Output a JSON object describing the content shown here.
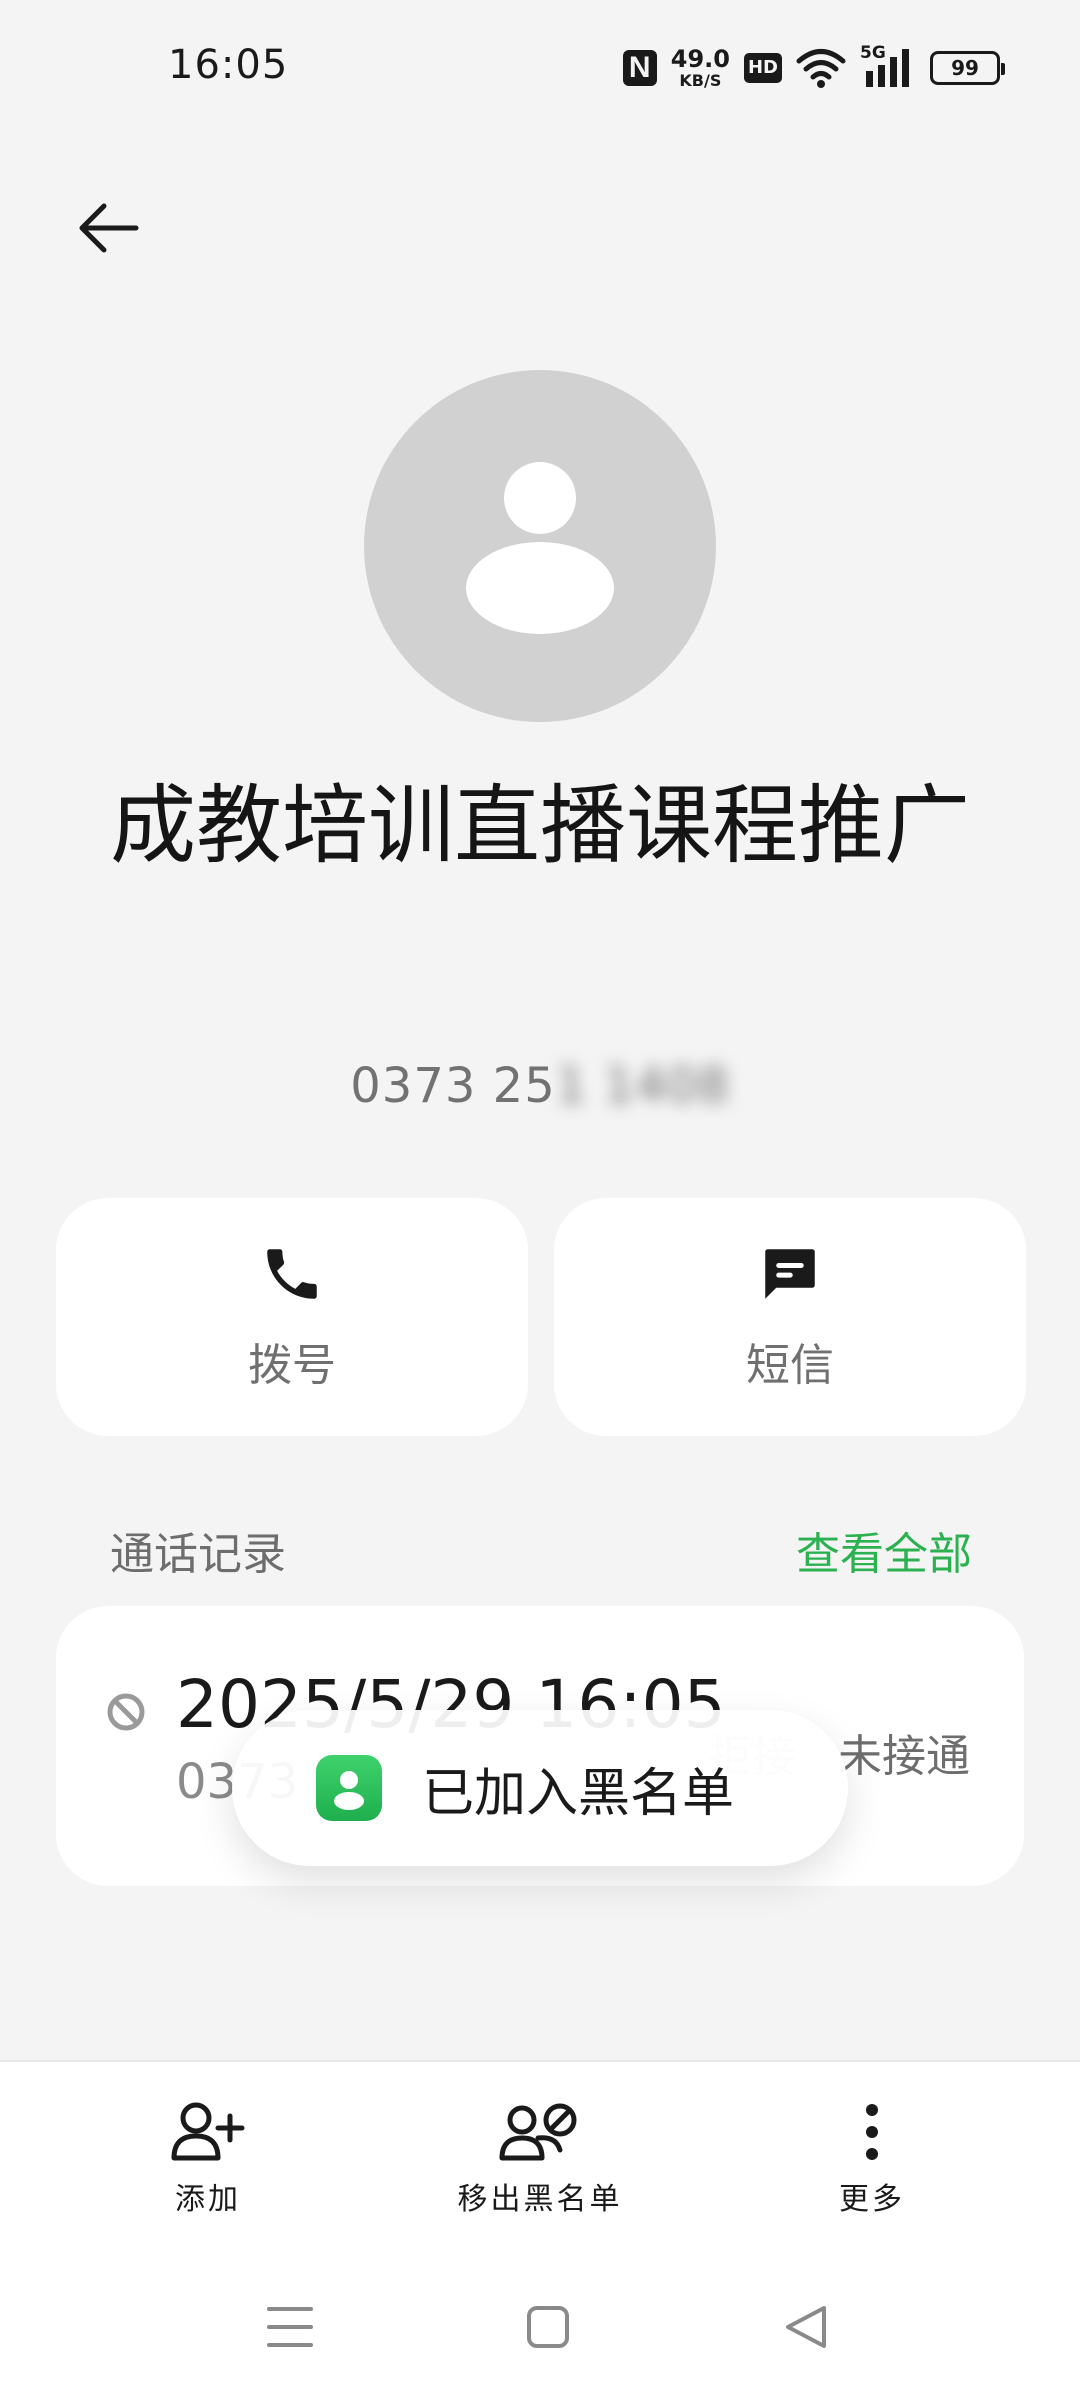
{
  "status_bar": {
    "time": "16:05",
    "net_speed_value": "49.0",
    "net_speed_unit": "KB/S",
    "hd_label": "HD",
    "network_label": "5G",
    "battery_level": "99",
    "icons": [
      "nfc-icon",
      "hd-icon",
      "wifi-icon",
      "signal-icon",
      "battery-icon"
    ]
  },
  "header": {
    "back_icon": "arrow-left-icon"
  },
  "contact": {
    "avatar_icon": "person-icon",
    "name": "成教培训直播课程推广",
    "phone_visible": "0373 25",
    "phone_blurred": "1 1408"
  },
  "actions": {
    "dial": {
      "label": "拨号",
      "icon": "phone-icon"
    },
    "sms": {
      "label": "短信",
      "icon": "message-icon"
    }
  },
  "call_history": {
    "title": "通话记录",
    "view_all": "查看全部",
    "record": {
      "date": "2025/5/29 16:05",
      "number": "0373",
      "reject_label": "拒接",
      "status": "未接通",
      "icon": "blocked-icon"
    }
  },
  "toast": {
    "text": "已加入黑名单",
    "icon": "contacts-app-icon"
  },
  "bottom_bar": {
    "add": {
      "label": "添加",
      "icon": "add-person-icon"
    },
    "unblock": {
      "label": "移出黑名单",
      "icon": "unblock-people-icon"
    },
    "more": {
      "label": "更多",
      "icon": "more-vertical-icon"
    }
  },
  "nav": {
    "icons": [
      "menu-icon",
      "home-icon",
      "back-triangle-icon"
    ]
  },
  "colors": {
    "accent_green": "#2bb14f",
    "background": "#f4f4f4",
    "card": "#ffffff"
  }
}
